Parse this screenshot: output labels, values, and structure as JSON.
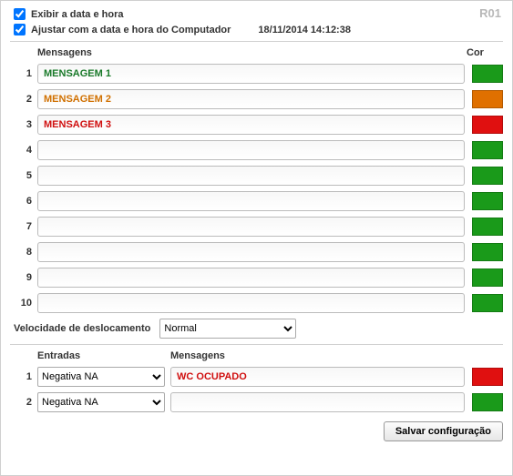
{
  "panel_id": "R01",
  "checkboxes": {
    "show_datetime_label": "Exibir a data e hora",
    "show_datetime_checked": true,
    "sync_computer_label": "Ajustar com a data e hora do Computador",
    "sync_computer_checked": true
  },
  "datetime_value": "18/11/2014 14:12:38",
  "messages_header": "Mensagens",
  "color_header": "Cor",
  "messages": [
    {
      "num": "1",
      "text": "MENSAGEM 1",
      "text_color": "#1a7a2a",
      "swatch": "#1a9a1a"
    },
    {
      "num": "2",
      "text": "MENSAGEM 2",
      "text_color": "#d07000",
      "swatch": "#e07000"
    },
    {
      "num": "3",
      "text": "MENSAGEM 3",
      "text_color": "#d01010",
      "swatch": "#e01010"
    },
    {
      "num": "4",
      "text": "",
      "text_color": "#333333",
      "swatch": "#1a9a1a"
    },
    {
      "num": "5",
      "text": "",
      "text_color": "#333333",
      "swatch": "#1a9a1a"
    },
    {
      "num": "6",
      "text": "",
      "text_color": "#333333",
      "swatch": "#1a9a1a"
    },
    {
      "num": "7",
      "text": "",
      "text_color": "#333333",
      "swatch": "#1a9a1a"
    },
    {
      "num": "8",
      "text": "",
      "text_color": "#333333",
      "swatch": "#1a9a1a"
    },
    {
      "num": "9",
      "text": "",
      "text_color": "#333333",
      "swatch": "#1a9a1a"
    },
    {
      "num": "10",
      "text": "",
      "text_color": "#333333",
      "swatch": "#1a9a1a"
    }
  ],
  "speed_label": "Velocidade de deslocamento",
  "speed_value": "Normal",
  "entries_header": "Entradas",
  "entries_msg_header": "Mensagens",
  "entry_option": "Negativa NA",
  "entries": [
    {
      "num": "1",
      "type": "Negativa NA",
      "msg": "WC OCUPADO",
      "msg_color": "#d01010",
      "swatch": "#e01010"
    },
    {
      "num": "2",
      "type": "Negativa NA",
      "msg": "",
      "msg_color": "#333333",
      "swatch": "#1a9a1a"
    }
  ],
  "save_label": "Salvar configuração"
}
